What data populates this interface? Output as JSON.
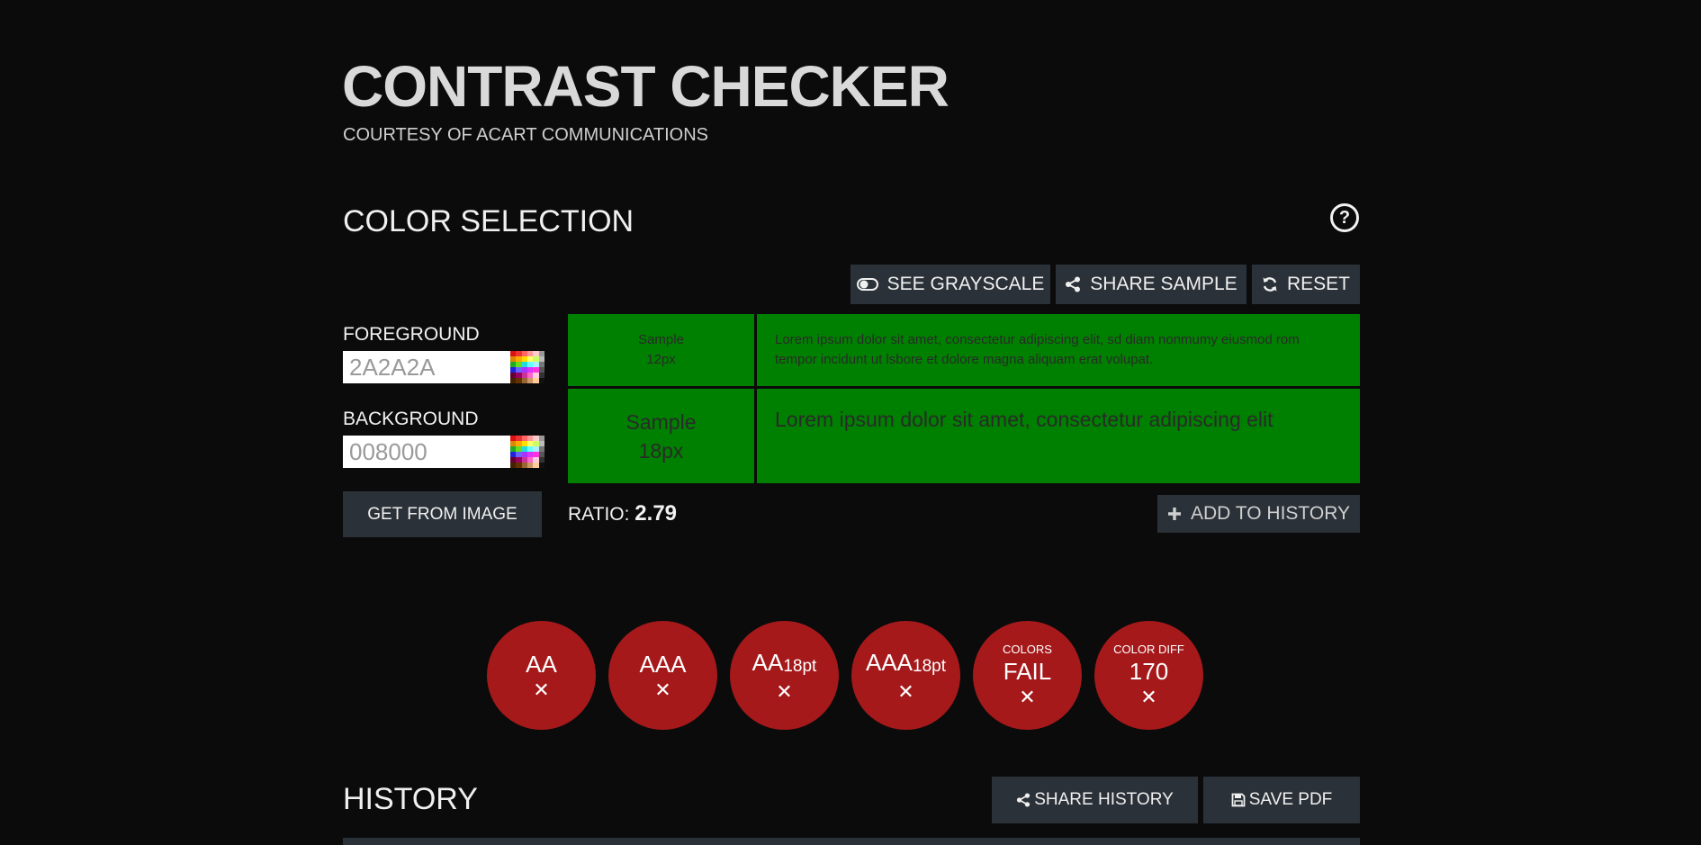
{
  "header": {
    "title": "CONTRAST CHECKER",
    "subtitle": "COURTESY OF ACART COMMUNICATIONS"
  },
  "color_selection": {
    "title": "COLOR SELECTION",
    "help_icon": "question-circle-icon",
    "toolbar": {
      "grayscale_label": "SEE GRAYSCALE",
      "share_sample_label": "SHARE SAMPLE",
      "reset_label": "RESET"
    },
    "foreground": {
      "label": "FOREGROUND",
      "value": "2A2A2A",
      "color": "#2a2a2a"
    },
    "background": {
      "label": "BACKGROUND",
      "value": "008000",
      "color": "#008000"
    },
    "get_from_image_label": "GET FROM IMAGE",
    "preview": {
      "small_sample_label": "Sample",
      "small_sample_size": "12px",
      "small_text": "Lorem ipsum dolor sit amet, consectetur adipiscing elit, sd diam nonmumy eiusmod rom tempor incidunt ut lsbore et dolore magna aliquam erat volupat.",
      "large_sample_label": "Sample",
      "large_sample_size": "18px",
      "large_text": "Lorem ipsum dolor sit amet, consectetur adipiscing elit"
    },
    "ratio_label": "RATIO:",
    "ratio_value": "2.79",
    "add_to_history_label": "ADD TO HISTORY"
  },
  "results": {
    "fail_color": "#a5191b",
    "badges": [
      {
        "top": "",
        "main": "AA",
        "suffix": "",
        "status": "✕"
      },
      {
        "top": "",
        "main": "AAA",
        "suffix": "",
        "status": "✕"
      },
      {
        "top": "",
        "main": "AA",
        "suffix": "18pt",
        "status": "✕"
      },
      {
        "top": "",
        "main": "AAA",
        "suffix": "18pt",
        "status": "✕"
      },
      {
        "top": "COLORS",
        "main": "FAIL",
        "suffix": "",
        "status": "✕"
      },
      {
        "top": "COLOR DIFF",
        "main": "170",
        "suffix": "",
        "status": "✕"
      }
    ]
  },
  "history": {
    "title": "HISTORY",
    "share_label": "SHARE HISTORY",
    "save_pdf_label": "SAVE PDF"
  }
}
